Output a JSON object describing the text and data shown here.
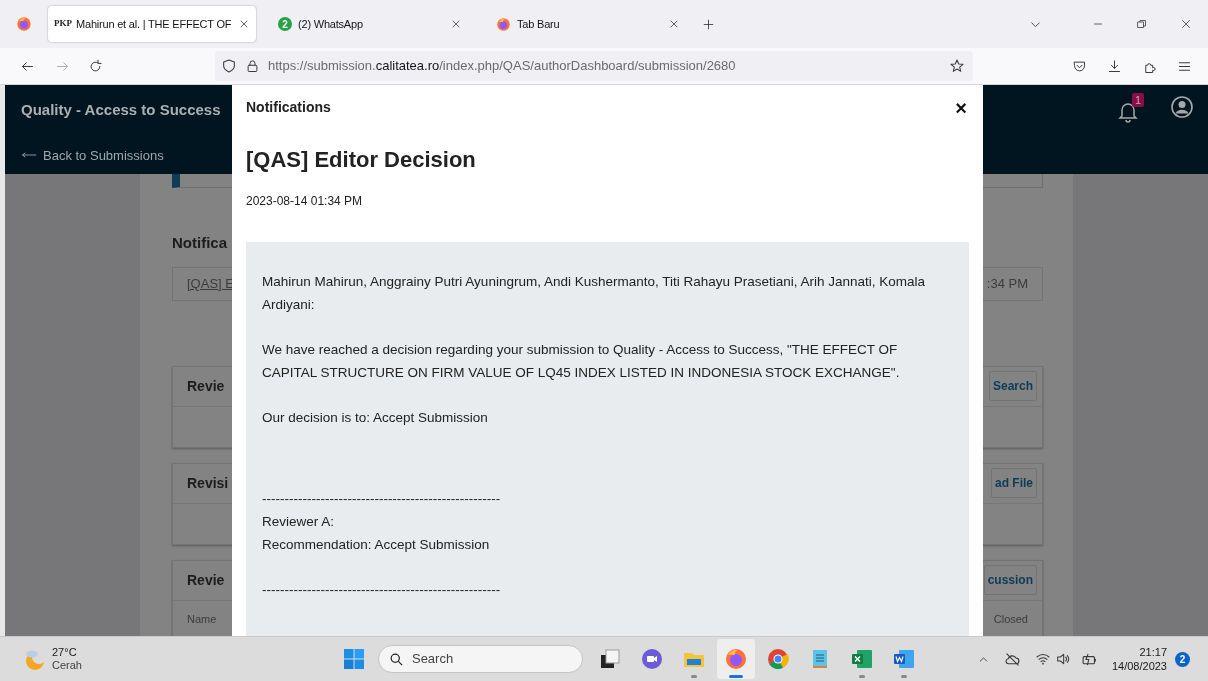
{
  "browser": {
    "tabs": [
      {
        "kind": "pkp",
        "favicon": "PKP",
        "title": "Mahirun et al. | THE EFFECT OF",
        "selected": true
      },
      {
        "kind": "whatsapp",
        "favicon": "2",
        "title": "(2) WhatsApp",
        "selected": false
      },
      {
        "kind": "firefox",
        "title": "Tab Baru",
        "selected": false
      }
    ],
    "url": {
      "prefix": "https://submission.",
      "domain": "calitatea.ro",
      "path": "/index.php/QAS/authorDashboard/submission/2680"
    }
  },
  "site_header": {
    "title": "Quality - Access to Success",
    "back_link": "Back to Submissions",
    "notification_count": "1"
  },
  "page": {
    "notifications_heading": "Notifica",
    "notification": {
      "link": "[QAS] E",
      "time": ":34 PM"
    },
    "panels": [
      {
        "title": "Revie",
        "button": "Search"
      },
      {
        "title": "Revisi",
        "button": "ad File"
      },
      {
        "title": "Revie",
        "button": "cussion",
        "column_left": "Name",
        "column_right": "Closed"
      }
    ]
  },
  "modal": {
    "heading": "Notifications",
    "close": "×",
    "title": "[QAS] Editor Decision",
    "date": "2023-08-14 01:34 PM",
    "message": [
      {
        "kind": "paragraph",
        "lines": [
          "Mahirun Mahirun, Anggrainy Putri Ayuningrum, Andi Kushermanto, Titi Rahayu Prasetiani, Arih Jannati, Komala Ardiyani:"
        ]
      },
      {
        "kind": "paragraph",
        "lines": [
          "We have reached a decision regarding your submission to Quality - Access to Success, \"THE EFFECT OF CAPITAL STRUCTURE ON FIRM VALUE OF LQ45 INDEX LISTED IN INDONESIA STOCK EXCHANGE\"."
        ]
      },
      {
        "kind": "paragraph",
        "lines": [
          "Our decision is to: Accept Submission"
        ]
      },
      {
        "kind": "gap"
      },
      {
        "kind": "paragraph",
        "lines": [
          "-----------------------------------------------------",
          "Reviewer A:",
          "Recommendation: Accept Submission"
        ]
      },
      {
        "kind": "paragraph",
        "lines": [
          "-----------------------------------------------------"
        ]
      }
    ]
  },
  "taskbar": {
    "weather": {
      "temperature": "27°C",
      "condition": "Cerah"
    },
    "search": "Search",
    "apps": [
      {
        "kind": "taskview",
        "running": false,
        "selected": false
      },
      {
        "kind": "chat",
        "running": false,
        "selected": false
      },
      {
        "kind": "explorer",
        "running": true,
        "selected": false
      },
      {
        "kind": "firefox",
        "running": true,
        "selected": true
      },
      {
        "kind": "chrome",
        "running": false,
        "selected": false
      },
      {
        "kind": "notepad",
        "running": false,
        "selected": false
      },
      {
        "kind": "excel",
        "running": true,
        "selected": false
      },
      {
        "kind": "word",
        "running": true,
        "selected": false
      }
    ],
    "time": "21:17",
    "date": "14/08/2023",
    "notifications": "2"
  }
}
